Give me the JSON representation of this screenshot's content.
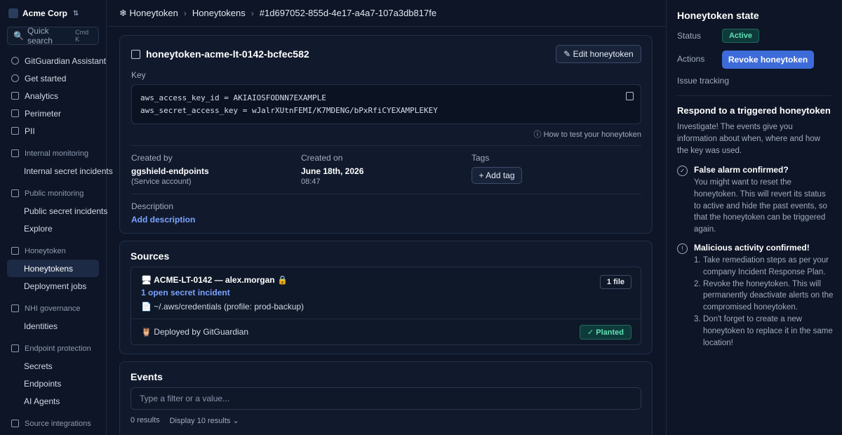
{
  "sidebar": {
    "org_name": "Acme Corp",
    "search_placeholder": "Quick search",
    "search_shortcut": "Cmd K",
    "items": [
      {
        "label": "GitGuardian Assistant"
      },
      {
        "label": "Get started"
      },
      {
        "label": "Analytics"
      },
      {
        "label": "Perimeter"
      },
      {
        "label": "PII"
      }
    ],
    "sections": [
      {
        "label": "Internal monitoring",
        "items": [
          "Internal secret incidents"
        ]
      },
      {
        "label": "Public monitoring",
        "items": [
          "Public secret incidents",
          "Explore"
        ]
      },
      {
        "label": "Honeytoken",
        "items": [
          "Honeytokens",
          "Deployment jobs"
        ]
      },
      {
        "label": "NHI governance",
        "items": [
          "Identities"
        ]
      },
      {
        "label": "Endpoint protection",
        "items": [
          "Secrets",
          "Endpoints",
          "AI Agents"
        ]
      },
      {
        "label": "Source integrations",
        "items": []
      }
    ]
  },
  "breadcrumb": {
    "root": "❄ Honeytoken",
    "section": "Honeytokens",
    "current": "#1d697052-855d-4e17-a4a7-107a3db817fe"
  },
  "detail": {
    "name": "honeytoken-acme-lt-0142-bcfec582",
    "edit_label": "✎ Edit honeytoken",
    "key_label": "Key",
    "key_lines": [
      "aws_access_key_id = AKIAIOSFODNN7EXAMPLE",
      "aws_secret_access_key = wJalrXUtnFEMI/K7MDENG/bPxRfiCYEXAMPLEKEY"
    ],
    "howto": "ⓘ How to test your honeytoken",
    "created_by_label": "Created by",
    "created_by": "ggshield-endpoints",
    "created_by_sub": "(Service account)",
    "created_on_label": "Created on",
    "created_on": "June 18th, 2026",
    "created_on_time": "08:47",
    "tags_label": "Tags",
    "add_tag": "+ Add tag",
    "description_label": "Description",
    "add_description": "Add description"
  },
  "sources": {
    "title": "Sources",
    "source_name": "🖥 ACME-LT-0142 — alex.morgan 🔒",
    "incident_link": "1 open secret incident",
    "path": "📄 ~/.aws/credentials (profile: prod-backup)",
    "file_badge": "1 file",
    "deployed": "🦉 Deployed by GitGuardian",
    "planted": "✓ Planted"
  },
  "events": {
    "title": "Events",
    "filter_placeholder": "Type a filter or a value...",
    "results": "0 results",
    "display": "Display 10 results ⌄"
  },
  "state": {
    "title": "Honeytoken state",
    "status_label": "Status",
    "status": "Active",
    "actions_label": "Actions",
    "revoke": "Revoke honeytoken",
    "issue_tracking": "Issue tracking",
    "respond_title": "Respond to a triggered honeytoken",
    "respond_intro": "Investigate! The events give you information about when, where and how the key was used.",
    "false_alarm_title": "False alarm confirmed?",
    "false_alarm_body": "You might want to reset the honeytoken. This will revert its status to active and hide the past events, so that the honeytoken can be triggered again.",
    "malicious_title": "Malicious activity confirmed!",
    "malicious_steps": [
      "Take remediation steps as per your company Incident Response Plan.",
      "Revoke the honeytoken. This will permanently deactivate alerts on the compromised honeytoken.",
      "Don't forget to create a new honeytoken to replace it in the same location!"
    ]
  },
  "colors": {
    "background": "#0d1526",
    "card": "#111a2d",
    "accent": "#3d6bd9",
    "link": "#7aa3ff",
    "success": "#5fe0b5"
  }
}
